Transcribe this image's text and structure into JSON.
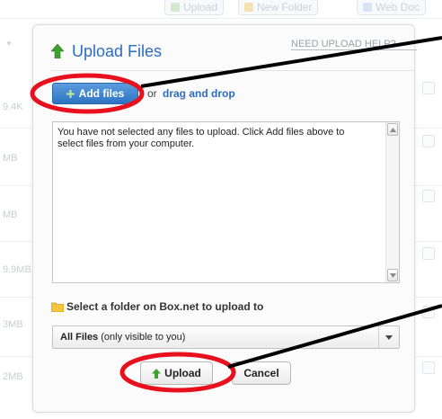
{
  "background": {
    "toolbar": {
      "upload_label": "Upload",
      "new_folder_label": "New Folder",
      "web_doc_label": "Web Doc"
    },
    "file_sizes": [
      "9.4K",
      "MB",
      "MB",
      "9.9MB",
      "3MB",
      "2MB"
    ]
  },
  "dialog": {
    "title": "Upload Files",
    "help_link": "NEED UPLOAD HELP?",
    "add_files_label": "Add files",
    "or_text": "or",
    "drag_drop_text": "drag and drop",
    "file_list_message": "You have not selected any files to upload. Click Add files above to select files from your computer.",
    "folder_prompt": "Select a folder on Box.net to upload to",
    "folder_select": {
      "selected_name": "All Files",
      "selected_note": "(only visible to you)"
    },
    "upload_label": "Upload",
    "cancel_label": "Cancel"
  },
  "colors": {
    "title_blue": "#2f6bbd",
    "add_button_blue": "#2e73c3",
    "annotation_red": "#e8101c",
    "upload_arrow_green": "#3f9f2f"
  },
  "icons": {
    "title": "upload-arrow-icon",
    "add_files": "plus-icon",
    "folder": "folder-icon",
    "upload_button": "upload-arrow-icon",
    "scroll_up": "chevron-up-icon",
    "scroll_down": "chevron-down-icon",
    "select": "chevron-down-icon"
  }
}
